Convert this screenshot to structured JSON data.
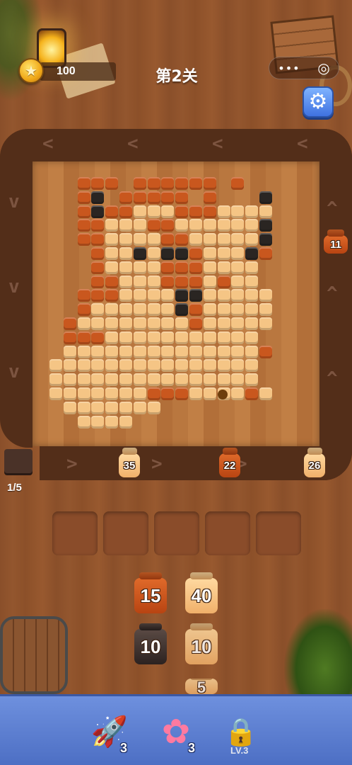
{
  "header": {
    "coins": "100",
    "level_title": "第2关",
    "capsule_dots": "•••",
    "capsule_target": "◎"
  },
  "track": {
    "side_jar": "11",
    "conveyor_jars": [
      "35",
      "22",
      "26"
    ],
    "stack_count": "1/5"
  },
  "slots": 5,
  "queue": {
    "column1": [
      "15",
      "10"
    ],
    "column2": [
      "40",
      "10",
      "5"
    ]
  },
  "toolbar": {
    "rocket_count": "3",
    "pinwheel_count": "3",
    "locked_label": "LV.3"
  },
  "colors": {
    "orange": "#c9571e",
    "light": "#f5c585",
    "dark": "#2a2522",
    "track": "#532e19",
    "bar": "#5a7dd1"
  },
  "icons": {
    "coin": "coin-icon",
    "gear": "gear-icon",
    "rocket": "rocket-icon",
    "pinwheel": "pinwheel-icon",
    "lock": "lock-icon"
  },
  "pixel_art": [
    "..ooo.oooooo.o..",
    "..od.ooooo.o...d",
    "..odoolllooollll",
    "..oollloolllllld",
    "..oolllloollllld",
    "...olldlddollldo",
    "...ollllooollll.",
    "...oolllooololl.",
    "..ooollllddlllll",
    "..olllllldolllll",
    ".ollllllllolllll",
    ".ooolllllllllll.",
    ".llllllllllllllo",
    "lllllllllllllll.",
    "lllllllllllllll.",
    "lllllllooollllol",
    ".lllllll..........",
    "..llll..........."
  ]
}
